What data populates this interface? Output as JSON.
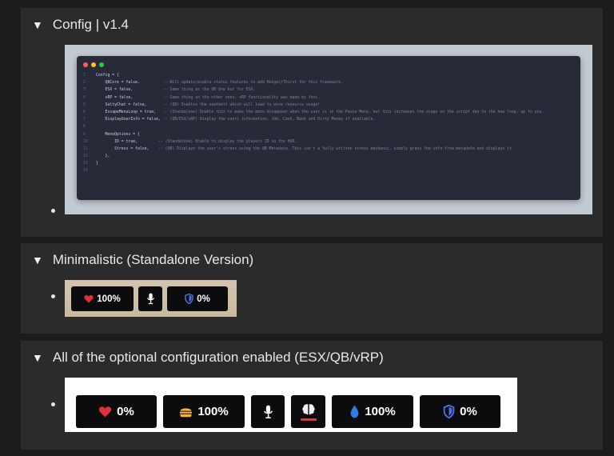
{
  "sections": {
    "config": {
      "title": "Config | v1.4",
      "code": {
        "dot_colors": [
          "#ff5f56",
          "#ffbd2e",
          "#27c93f"
        ],
        "lines": [
          {
            "num": "1",
            "code": "Config = {",
            "comment": ""
          },
          {
            "num": "2",
            "code": "    QBCore = false,          ",
            "comment": "-- Will update/enable status features to add Hunger/Thirst for this framework."
          },
          {
            "num": "3",
            "code": "    ESX = false,             ",
            "comment": "-- Same thing as the QB One but for ESX."
          },
          {
            "num": "4",
            "code": "    vRP = false,             ",
            "comment": "-- Same thing as the other ones. vRP functionality was made by Yoxi."
          },
          {
            "num": "5",
            "code": "    SaltyChat = false,       ",
            "comment": "-- (QB) Enables the seatbelt which will lead to more resource usage!"
          },
          {
            "num": "6",
            "code": "    EscapeMenuLoop = true,   ",
            "comment": "-- (Standalone) Enable this to make the menu disappear when the user is in the Pause Menu, but this increases the usage on the script due to the new loop, up to you."
          },
          {
            "num": "7",
            "code": "    DisplayUserInfo = false, ",
            "comment": "-- (QB/ESX/vRP) Display the users information, Job, Cash, Bank and Dirty Money if available."
          },
          {
            "num": "8",
            "code": "",
            "comment": ""
          },
          {
            "num": "9",
            "code": "    MenuOptions = {",
            "comment": ""
          },
          {
            "num": "10",
            "code": "        ID = true,         ",
            "comment": "-- (Standalone) Enable to display the players ID in the HUD."
          },
          {
            "num": "11",
            "code": "        Stress = false,    ",
            "comment": "-- (QB) Displays the user's stress using the QB Metadata. This isn't a fully written stress mechanic, simply grabs the info from metadata and displays it."
          },
          {
            "num": "12",
            "code": "    },",
            "comment": ""
          },
          {
            "num": "13",
            "code": "}",
            "comment": ""
          },
          {
            "num": "14",
            "code": "",
            "comment": ""
          }
        ]
      }
    },
    "minimalistic": {
      "title": "Minimalistic (Standalone Version)",
      "hud": {
        "health": "100%",
        "armor": "0%"
      }
    },
    "all_options": {
      "title": "All of the optional configuration enabled (ESX/QB/vRP)",
      "hud": {
        "health": "0%",
        "hunger": "100%",
        "thirst": "100%",
        "armor": "0%"
      }
    }
  },
  "colors": {
    "heart": "#e0303c",
    "burger": "#f5b23b",
    "water": "#2f7de8",
    "shield": "#4a6fe0",
    "stress_bar": "#d93a3a"
  },
  "icons": {
    "disclosure": "triangle-down-icon",
    "health": "heart-icon",
    "hunger": "burger-icon",
    "voice": "microphone-icon",
    "stress": "brain-icon",
    "thirst": "water-drop-icon",
    "armor": "shield-icon"
  }
}
